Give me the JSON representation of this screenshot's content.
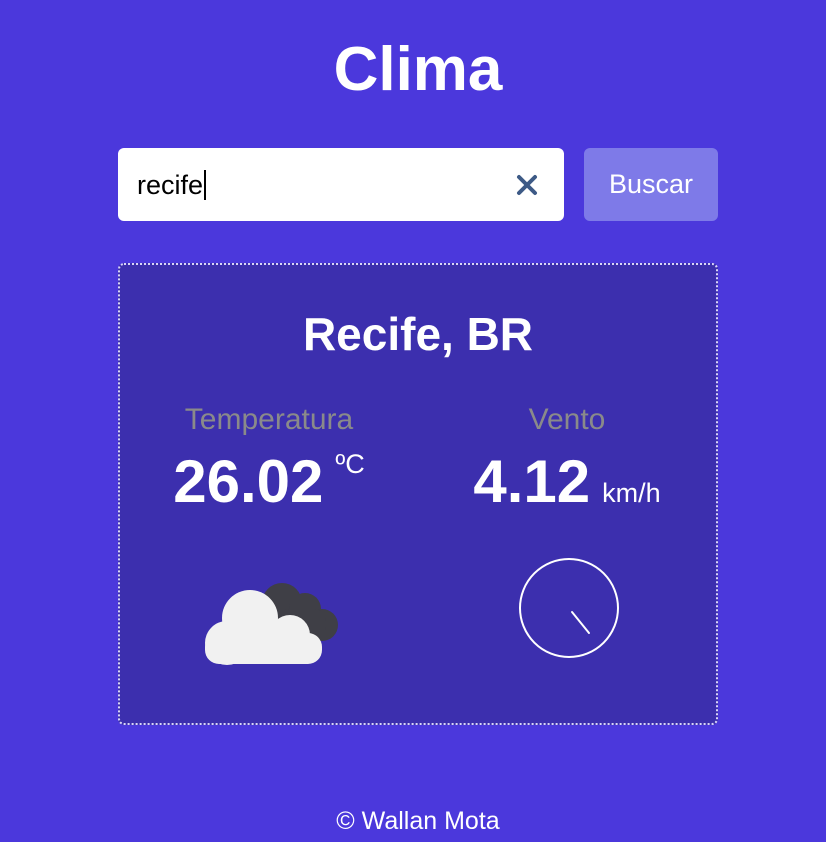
{
  "app": {
    "title": "Clima"
  },
  "search": {
    "value": "recife",
    "button_label": "Buscar",
    "clear_icon": "close-icon"
  },
  "weather": {
    "location": "Recife, BR",
    "temperature": {
      "label": "Temperatura",
      "value": "26.02",
      "unit": "ºC"
    },
    "wind": {
      "label": "Vento",
      "value": "4.12",
      "unit": "km/h"
    },
    "condition_icon": "cloud-icon",
    "wind_direction_icon": "compass-icon"
  },
  "footer": {
    "text": "© Wallan Mota"
  },
  "colors": {
    "background": "#4b38dc",
    "card": "#3c2fae",
    "button": "#7e7ae8",
    "muted_label": "#8a8a8a"
  }
}
